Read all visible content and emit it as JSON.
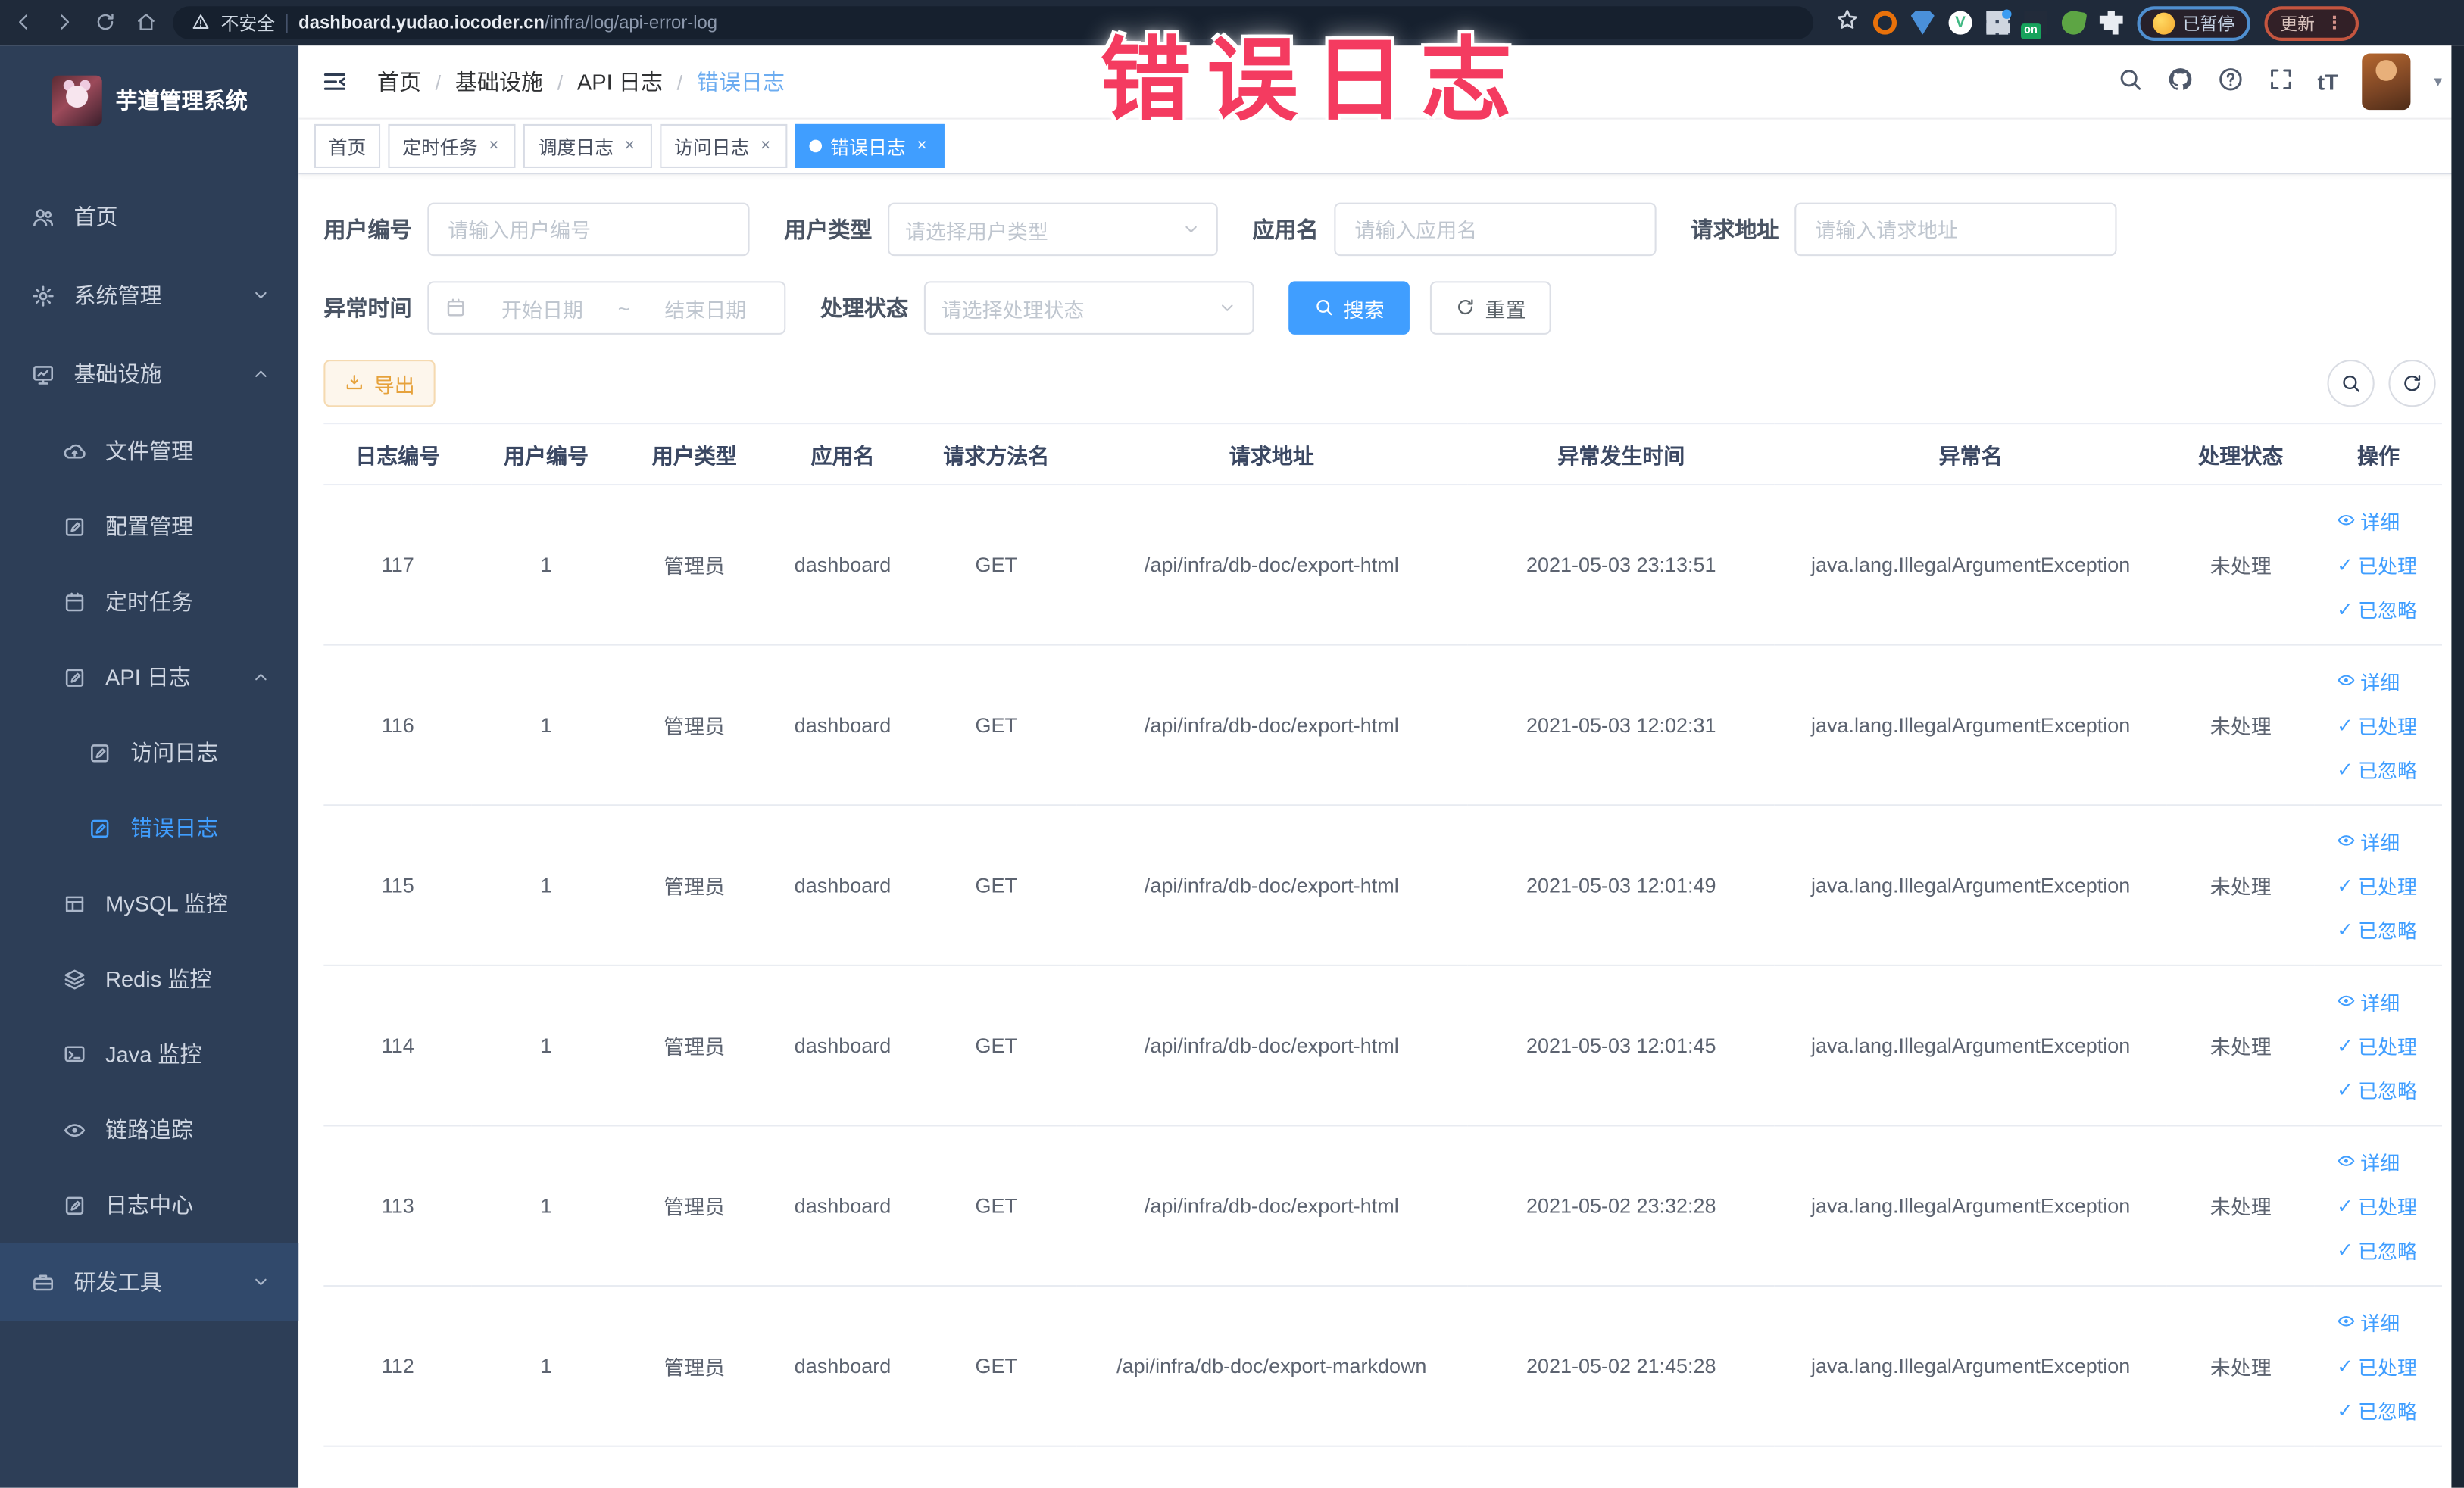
{
  "browser": {
    "security_label": "不安全",
    "url_domain": "dashboard.yudao.iocoder.cn",
    "url_path": "/infra/log/api-error-log",
    "profile_badge": "已暂停",
    "update_button": "更新",
    "extensions": [
      {
        "name": "bookmark-star-icon",
        "type": "star"
      },
      {
        "name": "orange-ring-extension-icon",
        "type": "orange"
      },
      {
        "name": "blue-shield-extension-icon",
        "type": "shield"
      },
      {
        "name": "vue-devtools-icon",
        "type": "vue"
      },
      {
        "name": "grid-extension-icon",
        "type": "grid"
      },
      {
        "name": "switch-on-extension-icon",
        "type": "on"
      },
      {
        "name": "green-leaf-extension-icon",
        "type": "leaf"
      },
      {
        "name": "puzzle-extension-icon",
        "type": "puzzle"
      }
    ]
  },
  "annotation": {
    "text": "错误日志",
    "color": "#f43b60"
  },
  "sidebar": {
    "title": "芋道管理系统",
    "items": [
      {
        "name": "home",
        "label": "首页",
        "icon": "people-icon",
        "glyph": "people",
        "level": 0
      },
      {
        "name": "system-management",
        "label": "系统管理",
        "icon": "gear-icon",
        "glyph": "gear",
        "level": 0,
        "arrow": "down"
      },
      {
        "name": "infrastructure",
        "label": "基础设施",
        "icon": "monitor-icon",
        "glyph": "monitor",
        "level": 0,
        "arrow": "up"
      },
      {
        "name": "file-management",
        "label": "文件管理",
        "icon": "cloud-upload-icon",
        "glyph": "cloud",
        "level": 1
      },
      {
        "name": "config-management",
        "label": "配置管理",
        "icon": "edit-icon",
        "glyph": "edit",
        "level": 1
      },
      {
        "name": "scheduled-tasks",
        "label": "定时任务",
        "icon": "schedule-icon",
        "glyph": "calendar",
        "level": 1
      },
      {
        "name": "api-log",
        "label": "API 日志",
        "icon": "log-icon",
        "glyph": "edit",
        "level": 1,
        "arrow": "up"
      },
      {
        "name": "access-log",
        "label": "访问日志",
        "icon": "log-icon",
        "glyph": "edit",
        "level": 2
      },
      {
        "name": "error-log",
        "label": "错误日志",
        "icon": "log-icon",
        "glyph": "edit",
        "level": 2,
        "active": true
      },
      {
        "name": "mysql-monitor",
        "label": "MySQL 监控",
        "icon": "database-icon",
        "glyph": "db",
        "level": 1
      },
      {
        "name": "redis-monitor",
        "label": "Redis 监控",
        "icon": "layers-icon",
        "glyph": "layers",
        "level": 1
      },
      {
        "name": "java-monitor",
        "label": "Java 监控",
        "icon": "terminal-icon",
        "glyph": "java",
        "level": 1
      },
      {
        "name": "trace",
        "label": "链路追踪",
        "icon": "eye-icon",
        "glyph": "eye",
        "level": 1
      },
      {
        "name": "log-center",
        "label": "日志中心",
        "icon": "log-icon",
        "glyph": "edit",
        "level": 1
      },
      {
        "name": "dev-tools",
        "label": "研发工具",
        "icon": "toolbox-icon",
        "glyph": "toolbox",
        "level": 0,
        "arrow": "down",
        "section": "dev"
      }
    ]
  },
  "breadcrumb": {
    "items": [
      "首页",
      "基础设施",
      "API 日志",
      "错误日志"
    ]
  },
  "tabs": [
    {
      "name": "tab-home",
      "label": "首页",
      "closable": false,
      "active": false
    },
    {
      "name": "tab-scheduled-tasks",
      "label": "定时任务",
      "closable": true,
      "active": false
    },
    {
      "name": "tab-schedule-log",
      "label": "调度日志",
      "closable": true,
      "active": false
    },
    {
      "name": "tab-access-log",
      "label": "访问日志",
      "closable": true,
      "active": false
    },
    {
      "name": "tab-error-log",
      "label": "错误日志",
      "closable": true,
      "active": true
    }
  ],
  "filters": {
    "user_id": {
      "label": "用户编号",
      "placeholder": "请输入用户编号"
    },
    "user_type": {
      "label": "用户类型",
      "placeholder": "请选择用户类型"
    },
    "app_name": {
      "label": "应用名",
      "placeholder": "请输入应用名"
    },
    "request_url": {
      "label": "请求地址",
      "placeholder": "请输入请求地址"
    },
    "exception_time": {
      "label": "异常时间",
      "start_placeholder": "开始日期",
      "separator": "~",
      "end_placeholder": "结束日期"
    },
    "process_status": {
      "label": "处理状态",
      "placeholder": "请选择处理状态"
    },
    "search_button": "搜索",
    "reset_button": "重置"
  },
  "toolbar": {
    "export_button": "导出"
  },
  "table": {
    "columns": [
      "日志编号",
      "用户编号",
      "用户类型",
      "应用名",
      "请求方法名",
      "请求地址",
      "异常发生时间",
      "异常名",
      "处理状态",
      "操作"
    ],
    "actions": [
      {
        "name": "detail-link",
        "label": "详细",
        "icon": "eye"
      },
      {
        "name": "processed-link",
        "label": "已处理",
        "icon": "check"
      },
      {
        "name": "ignored-link",
        "label": "已忽略",
        "icon": "check"
      }
    ],
    "rows": [
      {
        "id": "117",
        "user_id": "1",
        "user_type": "管理员",
        "app_name": "dashboard",
        "method": "GET",
        "url": "/api/infra/db-doc/export-html",
        "time": "2021-05-03 23:13:51",
        "exception": "java.lang.IllegalArgumentException",
        "status": "未处理"
      },
      {
        "id": "116",
        "user_id": "1",
        "user_type": "管理员",
        "app_name": "dashboard",
        "method": "GET",
        "url": "/api/infra/db-doc/export-html",
        "time": "2021-05-03 12:02:31",
        "exception": "java.lang.IllegalArgumentException",
        "status": "未处理"
      },
      {
        "id": "115",
        "user_id": "1",
        "user_type": "管理员",
        "app_name": "dashboard",
        "method": "GET",
        "url": "/api/infra/db-doc/export-html",
        "time": "2021-05-03 12:01:49",
        "exception": "java.lang.IllegalArgumentException",
        "status": "未处理"
      },
      {
        "id": "114",
        "user_id": "1",
        "user_type": "管理员",
        "app_name": "dashboard",
        "method": "GET",
        "url": "/api/infra/db-doc/export-html",
        "time": "2021-05-03 12:01:45",
        "exception": "java.lang.IllegalArgumentException",
        "status": "未处理"
      },
      {
        "id": "113",
        "user_id": "1",
        "user_type": "管理员",
        "app_name": "dashboard",
        "method": "GET",
        "url": "/api/infra/db-doc/export-html",
        "time": "2021-05-02 23:32:28",
        "exception": "java.lang.IllegalArgumentException",
        "status": "未处理"
      },
      {
        "id": "112",
        "user_id": "1",
        "user_type": "管理员",
        "app_name": "dashboard",
        "method": "GET",
        "url": "/api/infra/db-doc/export-markdown",
        "time": "2021-05-02 21:45:28",
        "exception": "java.lang.IllegalArgumentException",
        "status": "未处理"
      }
    ]
  },
  "glyphs": {
    "close": "×",
    "check": "✓",
    "question": "?",
    "text_size": "tT",
    "caret": "▾",
    "range_separator": "~",
    "more": "⋮",
    "vue": "V",
    "on": "on"
  },
  "colors": {
    "accent": "#409eff",
    "warning": "#e6a23c",
    "annotation": "#f43b60",
    "sidebar_bg": "#2d3e57"
  }
}
